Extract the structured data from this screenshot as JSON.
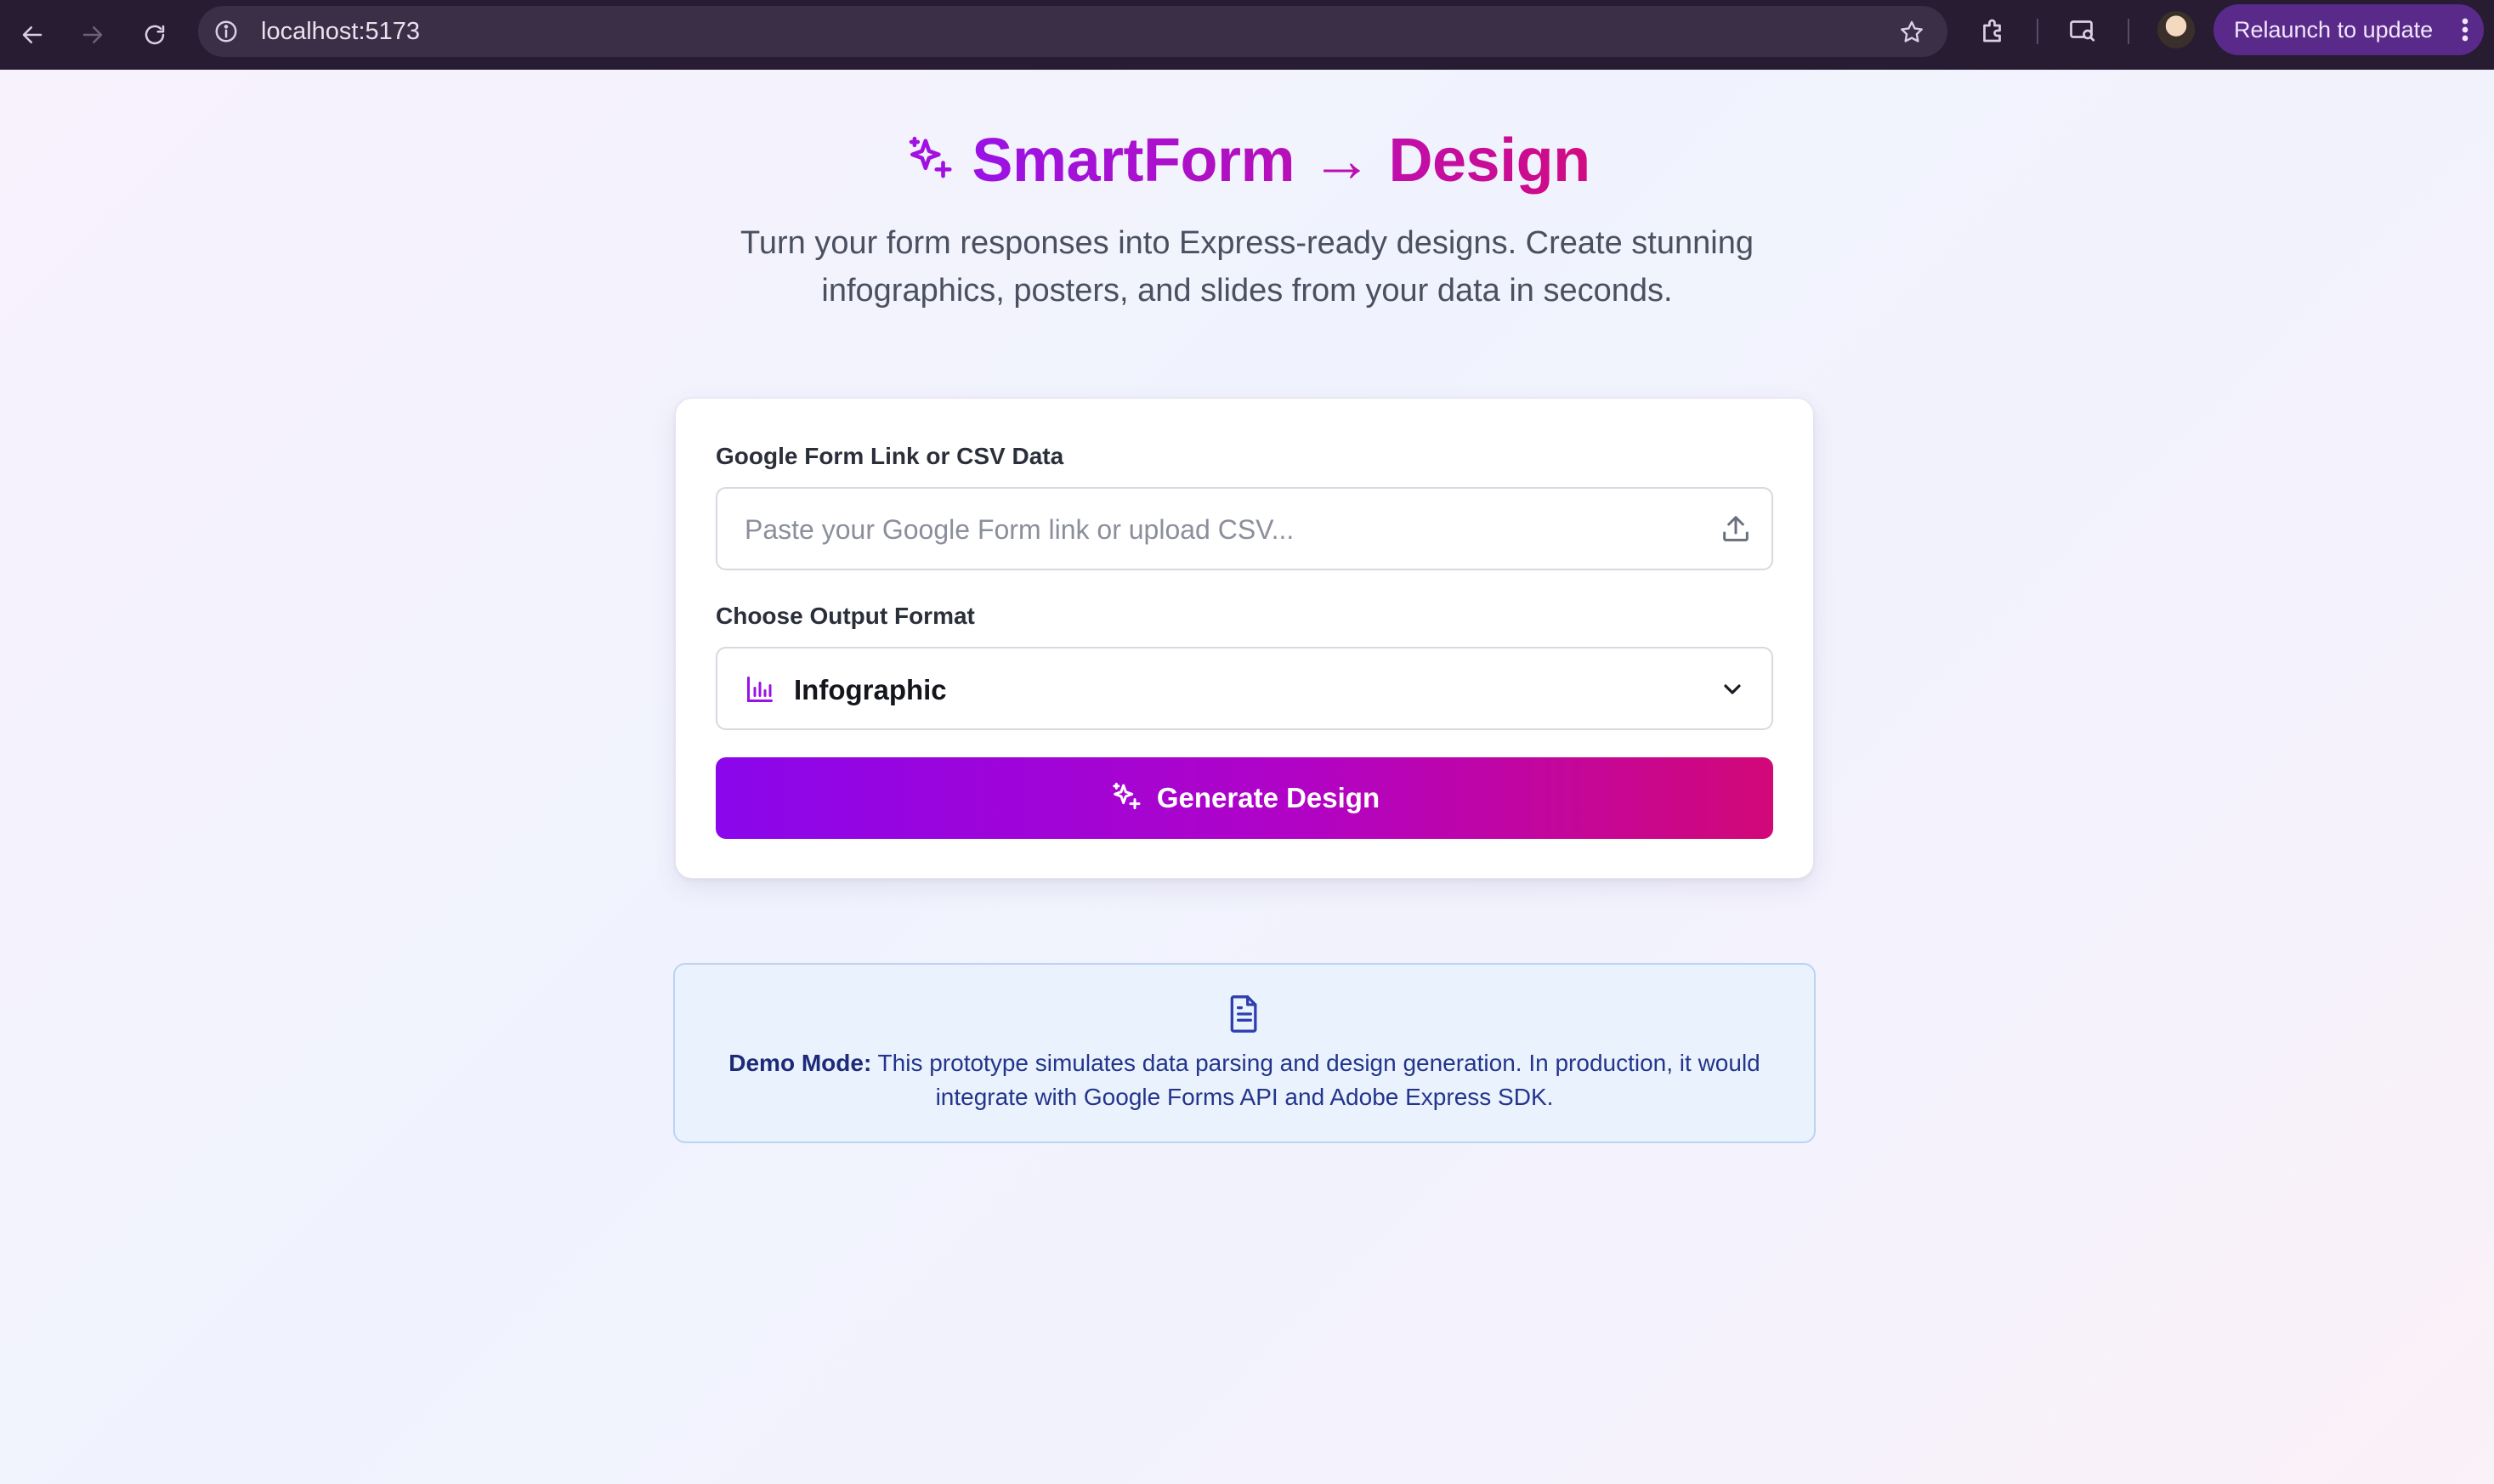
{
  "browser": {
    "url": "localhost:5173",
    "relaunch_label": "Relaunch to update"
  },
  "hero": {
    "title": "SmartForm → Design",
    "subtitle": "Turn your form responses into Express-ready designs. Create stunning infographics, posters, and slides from your data in seconds."
  },
  "form": {
    "source_label": "Google Form Link or CSV Data",
    "source_placeholder": "Paste your Google Form link or upload CSV...",
    "source_value": "",
    "format_label": "Choose Output Format",
    "format_value": "Infographic",
    "generate_label": "Generate Design"
  },
  "demo": {
    "heading": "Demo Mode:",
    "text": "This prototype simulates data parsing and design generation. In production, it would integrate with Google Forms API and Adobe Express SDK."
  },
  "colors": {
    "accent_start": "#8a06ec",
    "accent_end": "#d20878",
    "demo_text": "#23358c"
  },
  "icons": [
    "back-icon",
    "forward-icon",
    "reload-icon",
    "info-icon",
    "star-icon",
    "extensions-icon",
    "media-icon",
    "sparkles-icon",
    "upload-icon",
    "bar-chart-icon",
    "chevron-down-icon",
    "document-icon",
    "more-vert-icon"
  ]
}
